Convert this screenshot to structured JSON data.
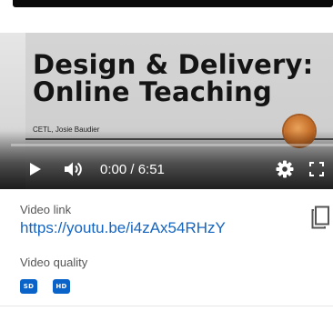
{
  "player": {
    "slide_title_line1": "Design & Delivery:",
    "slide_title_line2": "Online Teaching",
    "slide_author": "CETL, Josie Baudier",
    "time_display": "0:00 / 6:51",
    "progress_fraction": 0.0,
    "play_icon": "play-icon",
    "volume_icon": "volume-icon",
    "settings_icon": "gear-icon",
    "fullscreen_icon": "fullscreen-icon"
  },
  "info": {
    "video_link_label": "Video link",
    "video_url": "https://youtu.be/i4zAx54RHzY",
    "copy_icon": "copy-icon",
    "video_quality_label": "Video quality",
    "quality_options": [
      "SD",
      "HD"
    ]
  },
  "colors": {
    "link": "#1565c0",
    "badge": "#0a63c9",
    "progress": "#ff0000"
  }
}
